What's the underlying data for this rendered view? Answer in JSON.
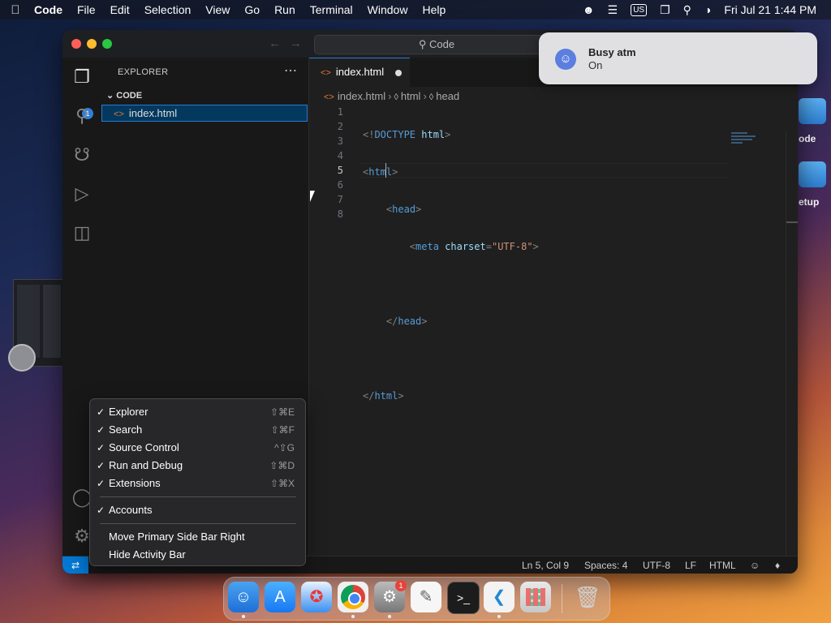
{
  "menubar": {
    "app_name": "Code",
    "menus": [
      "File",
      "Edit",
      "Selection",
      "View",
      "Go",
      "Run",
      "Terminal",
      "Window",
      "Help"
    ],
    "input_source": "US",
    "datetime": "Fri Jul 21  1:44 PM"
  },
  "desktop": {
    "label1": "ode",
    "label2": "etup"
  },
  "window": {
    "command_center": "Code",
    "explorer_badge": "1",
    "sidebar": {
      "title": "EXPLORER",
      "more": "⋯",
      "folder": "CODE",
      "file": "index.html"
    },
    "tab": {
      "label": "index.html"
    },
    "breadcrumb": [
      "index.html",
      "html",
      "head"
    ],
    "line_numbers": [
      "1",
      "2",
      "3",
      "4",
      "5",
      "6",
      "7",
      "8"
    ],
    "code": {
      "l1": {
        "open": "<!",
        "kw": "DOCTYPE",
        "attr": " html",
        "close": ">"
      },
      "l2": {
        "open": "<",
        "tag": "html",
        "close": ">"
      },
      "l3": {
        "indent": "    ",
        "open": "<",
        "tag": "head",
        "close": ">"
      },
      "l4": {
        "indent": "        ",
        "open": "<",
        "tag": "meta",
        "attr": " charset",
        "eq": "=",
        "str": "\"UTF-8\"",
        "close": ">"
      },
      "l6": {
        "indent": "    ",
        "open": "</",
        "tag": "head",
        "close": ">"
      },
      "l8": {
        "open": "</",
        "tag": "html",
        "close": ">"
      }
    },
    "status": {
      "position": "Ln 5, Col 9",
      "spaces": "Spaces: 4",
      "encoding": "UTF-8",
      "eol": "LF",
      "language": "HTML"
    }
  },
  "context_menu": {
    "items": [
      {
        "label": "Explorer",
        "shortcut": "⇧⌘E",
        "checked": "✓"
      },
      {
        "label": "Search",
        "shortcut": "⇧⌘F",
        "checked": "✓"
      },
      {
        "label": "Source Control",
        "shortcut": "^⇧G",
        "checked": "✓"
      },
      {
        "label": "Run and Debug",
        "shortcut": "⇧⌘D",
        "checked": "✓"
      },
      {
        "label": "Extensions",
        "shortcut": "⇧⌘X",
        "checked": "✓"
      },
      {
        "label": "Accounts",
        "shortcut": "",
        "checked": "✓"
      },
      {
        "label": "Move Primary Side Bar Right",
        "shortcut": "",
        "checked": ""
      },
      {
        "label": "Hide Activity Bar",
        "shortcut": "",
        "checked": ""
      }
    ]
  },
  "notification": {
    "title": "Busy atm",
    "subtitle": "On"
  },
  "dock": {
    "settings_badge": "1"
  },
  "colors": {
    "accent": "#0078d4",
    "selection": "#03395e"
  }
}
